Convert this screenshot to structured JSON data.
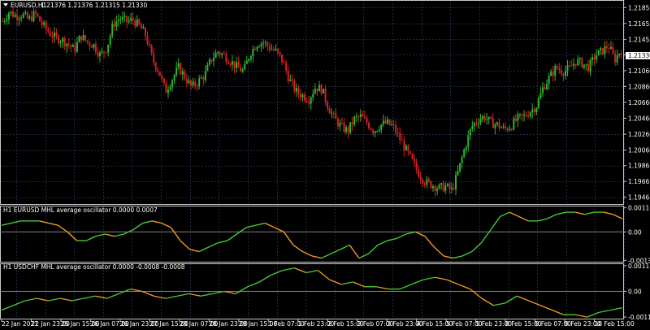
{
  "window": {
    "arrow_icon": "triangle-down-icon",
    "symbol_title": "EURUSD,H1",
    "ohlc": "1.21376 1.21376 1.21315 1.21330"
  },
  "price_axis": {
    "ticks": [
      "1.21855",
      "1.21655",
      "1.21455",
      "1.21260",
      "1.21060",
      "1.20860",
      "1.20660",
      "1.20460",
      "1.20260",
      "1.20060",
      "1.19865",
      "1.19665",
      "1.19465"
    ],
    "current_price": "1.21330"
  },
  "osc1": {
    "title": "H1 EURUSD MHL average oscillator 0.0000 0.0007",
    "ticks": [
      "0.0011",
      "0.00",
      "-0.0013"
    ]
  },
  "osc2": {
    "title": "H1 USDCHF MHL average oscillator 0.0000 -0.0008 -0.0008",
    "ticks": [
      "0.0011",
      "0.00",
      "-0.0011"
    ]
  },
  "time_axis": {
    "labels": [
      "22 Jan 2021",
      "22 Jan 23:00",
      "25 Jan 15:00",
      "26 Jan 07:00",
      "26 Jan 23:00",
      "27 Jan 15:00",
      "28 Jan 07:00",
      "28 Jan 23:00",
      "29 Jan 15:00",
      "1 Feb 07:00",
      "1 Feb 23:00",
      "2 Feb 15:00",
      "3 Feb 07:00",
      "3 Feb 23:00",
      "4 Feb 15:00",
      "5 Feb 07:00",
      "5 Feb 23:00",
      "8 Feb 15:00",
      "9 Feb 07:00",
      "9 Feb 23:00",
      "10 Feb 15:00"
    ]
  },
  "colors": {
    "background": "#000000",
    "grid": "#1e2a44",
    "frame": "#c8c8c8",
    "bull": "#2fb52f",
    "bear": "#d42020",
    "osc_up": "#44c93a",
    "osc_down": "#f09a1e",
    "zero_line": "#808080"
  },
  "chart_data": [
    {
      "type": "candlestick",
      "title": "EURUSD,H1",
      "ylim": [
        1.1937,
        1.2195
      ],
      "y_ticks": [
        1.21855,
        1.21655,
        1.21455,
        1.2126,
        1.2106,
        1.2086,
        1.2066,
        1.2046,
        1.2026,
        1.2006,
        1.19865,
        1.19665,
        1.19465
      ],
      "x_labels": [
        "22 Jan 2021",
        "22 Jan 23:00",
        "25 Jan 15:00",
        "26 Jan 07:00",
        "26 Jan 23:00",
        "27 Jan 15:00",
        "28 Jan 07:00",
        "28 Jan 23:00",
        "29 Jan 15:00",
        "1 Feb 07:00",
        "1 Feb 23:00",
        "2 Feb 15:00",
        "3 Feb 07:00",
        "3 Feb 23:00",
        "4 Feb 15:00",
        "5 Feb 07:00",
        "5 Feb 23:00",
        "8 Feb 15:00",
        "9 Feb 07:00",
        "9 Feb 23:00",
        "10 Feb 15:00"
      ],
      "close_path": [
        1.2168,
        1.218,
        1.2175,
        1.2177,
        1.217,
        1.2178,
        1.2165,
        1.2155,
        1.2148,
        1.2145,
        1.214,
        1.2132,
        1.215,
        1.2142,
        1.2138,
        1.2125,
        1.2135,
        1.2165,
        1.2172,
        1.2168,
        1.217,
        1.2162,
        1.215,
        1.212,
        1.2105,
        1.208,
        1.2095,
        1.211,
        1.2098,
        1.2085,
        1.2092,
        1.21,
        1.212,
        1.213,
        1.2125,
        1.2118,
        1.211,
        1.2105,
        1.2128,
        1.214,
        1.2142,
        1.2135,
        1.213,
        1.2118,
        1.2095,
        1.208,
        1.2075,
        1.207,
        1.2085,
        1.2083,
        1.206,
        1.2045,
        1.2035,
        1.203,
        1.2045,
        1.2048,
        1.204,
        1.203,
        1.2038,
        1.204,
        1.2035,
        1.202,
        1.2005,
        1.199,
        1.1975,
        1.1965,
        1.1962,
        1.1958,
        1.196,
        1.1955,
        1.198,
        1.201,
        1.2035,
        1.2045,
        1.2048,
        1.204,
        1.2038,
        1.2032,
        1.2036,
        1.2045,
        1.2048,
        1.2055,
        1.2062,
        1.2085,
        1.2098,
        1.211,
        1.2105,
        1.2108,
        1.2118,
        1.2115,
        1.211,
        1.2125,
        1.213,
        1.2138,
        1.212,
        1.2133
      ]
    },
    {
      "type": "line",
      "title": "H1 EURUSD MHL average oscillator 0.0000 0.0007",
      "ylim": [
        -0.0014,
        0.0012
      ],
      "values": [
        0.0003,
        0.0004,
        0.0005,
        0.0005,
        0.0005,
        0.0004,
        0.0003,
        0.0,
        -0.0004,
        -0.0004,
        -0.0002,
        -0.0001,
        -0.0002,
        -0.0001,
        0.0001,
        0.0004,
        0.0005,
        0.0004,
        0.0002,
        -0.0004,
        -0.0008,
        -0.0009,
        -0.0007,
        -0.0005,
        -0.0004,
        -0.0001,
        0.0002,
        0.0003,
        0.0004,
        0.0002,
        0.0,
        -0.0006,
        -0.0009,
        -0.0011,
        -0.0012,
        -0.001,
        -0.0008,
        -0.0006,
        -0.0012,
        -0.001,
        -0.0006,
        -0.0004,
        -0.0003,
        -0.0001,
        0.0,
        -0.0002,
        -0.0007,
        -0.0011,
        -0.0012,
        -0.0011,
        -0.0009,
        -0.0005,
        0.0001,
        0.0007,
        0.0009,
        0.0007,
        0.0005,
        0.0005,
        0.0006,
        0.0008,
        0.0009,
        0.0009,
        0.0008,
        0.0009,
        0.0009,
        0.0008,
        0.0006
      ]
    },
    {
      "type": "line",
      "title": "H1 USDCHF MHL average oscillator 0.0000 -0.0008 -0.0008",
      "ylim": [
        -0.0012,
        0.0012
      ],
      "values": [
        -0.0008,
        -0.0006,
        -0.0004,
        -0.0003,
        -0.0004,
        -0.0003,
        -0.0004,
        -0.0003,
        -0.0002,
        -0.0003,
        -0.0001,
        0.0001,
        0.0,
        -0.0002,
        -0.0003,
        -0.0002,
        -0.0001,
        -0.0002,
        -0.0001,
        0.0,
        -0.0001,
        0.0002,
        0.0004,
        0.0007,
        0.0009,
        0.001,
        0.0008,
        0.0009,
        0.0005,
        0.0003,
        0.0004,
        0.0002,
        0.0002,
        0.0001,
        0.0001,
        0.0003,
        0.0005,
        0.0006,
        0.0005,
        0.0003,
        0.0001,
        -0.0003,
        -0.0006,
        -0.0005,
        -0.0002,
        -0.0004,
        -0.0006,
        -0.0008,
        -0.001,
        -0.001,
        -0.0011,
        -0.0009,
        -0.0008,
        -0.0007
      ]
    }
  ]
}
